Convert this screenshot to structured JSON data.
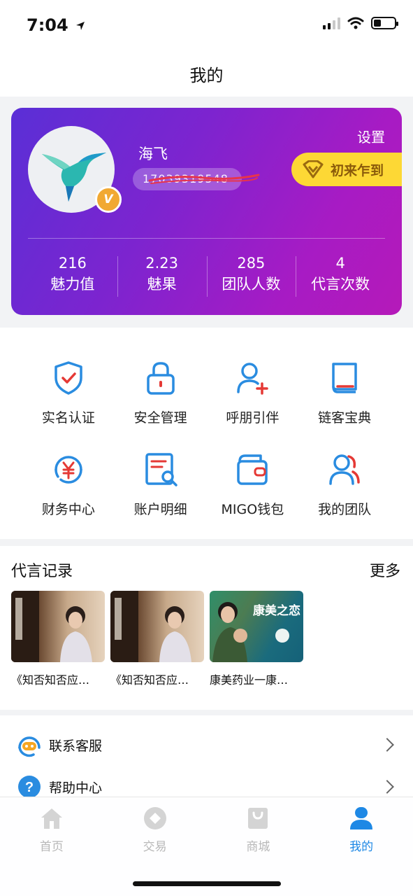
{
  "status_bar": {
    "time": "7:04"
  },
  "header": {
    "title": "我的"
  },
  "profile": {
    "name": "海飞",
    "phone_masked": "17039319548",
    "settings_label": "设置",
    "checkin_label": "初来乍到",
    "vip_badge": "V",
    "stats": [
      {
        "value": "216",
        "label": "魅力值"
      },
      {
        "value": "2.23",
        "label": "魅果"
      },
      {
        "value": "285",
        "label": "团队人数"
      },
      {
        "value": "4",
        "label": "代言次数"
      }
    ]
  },
  "menu": {
    "items": [
      {
        "label": "实名认证",
        "icon": "shield-check-icon"
      },
      {
        "label": "安全管理",
        "icon": "lock-icon"
      },
      {
        "label": "呼朋引伴",
        "icon": "user-add-icon"
      },
      {
        "label": "链客宝典",
        "icon": "book-icon"
      },
      {
        "label": "财务中心",
        "icon": "yen-circle-icon"
      },
      {
        "label": "账户明细",
        "icon": "document-search-icon"
      },
      {
        "label": "MIGO钱包",
        "icon": "wallet-icon"
      },
      {
        "label": "我的团队",
        "icon": "team-icon"
      }
    ]
  },
  "records": {
    "title": "代言记录",
    "more_label": "更多",
    "items": [
      {
        "title": "《知否知否应…"
      },
      {
        "title": "《知否知否应…"
      },
      {
        "title": "康美药业一康…",
        "thumb_text": "康美之恋"
      }
    ]
  },
  "list": {
    "items": [
      {
        "label": "联系客服",
        "icon": "customer-service-icon"
      },
      {
        "label": "帮助中心",
        "icon": "help-icon"
      }
    ]
  },
  "tab_bar": {
    "tabs": [
      {
        "label": "首页",
        "icon": "home-icon"
      },
      {
        "label": "交易",
        "icon": "trade-icon"
      },
      {
        "label": "商城",
        "icon": "shop-icon"
      },
      {
        "label": "我的",
        "icon": "profile-icon",
        "active": true
      }
    ]
  },
  "colors": {
    "accent": "#1e88e5",
    "card_start": "#5a2fd6",
    "card_end": "#b51ab9",
    "badge": "#fdd835",
    "icon_red": "#e53935"
  }
}
